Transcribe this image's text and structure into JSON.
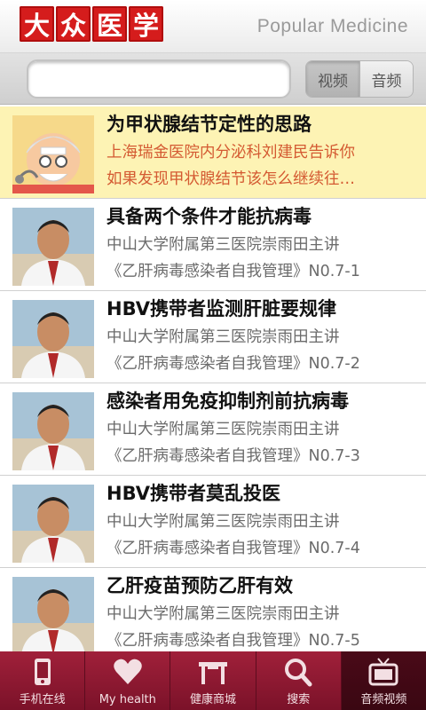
{
  "header": {
    "logo_chars": [
      "大",
      "众",
      "医",
      "学"
    ],
    "brand_text": "Popular Medicine"
  },
  "search": {
    "placeholder": "",
    "toggle": [
      {
        "label": "视频",
        "active": true
      },
      {
        "label": "音频",
        "active": false
      }
    ]
  },
  "list": {
    "items": [
      {
        "title": "为甲状腺结节定性的思路",
        "line1": "上海瑞金医院内分泌科刘建民告诉你",
        "line2": "如果发现甲状腺结节该怎么继续往…",
        "thumb_icon": "doctor-cartoon-icon",
        "highlighted": true
      },
      {
        "title": "具备两个条件才能抗病毒",
        "line1": "中山大学附属第三医院崇雨田主讲",
        "line2": "《乙肝病毒感染者自我管理》N0.7-1",
        "thumb_icon": "doctor-photo",
        "highlighted": false
      },
      {
        "title": "HBV携带者监测肝脏要规律",
        "line1": "中山大学附属第三医院崇雨田主讲",
        "line2": "《乙肝病毒感染者自我管理》N0.7-2",
        "thumb_icon": "doctor-photo",
        "highlighted": false
      },
      {
        "title": "感染者用免疫抑制剂前抗病毒",
        "line1": "中山大学附属第三医院崇雨田主讲",
        "line2": "《乙肝病毒感染者自我管理》N0.7-3",
        "thumb_icon": "doctor-photo",
        "highlighted": false
      },
      {
        "title": "HBV携带者莫乱投医",
        "line1": "中山大学附属第三医院崇雨田主讲",
        "line2": "《乙肝病毒感染者自我管理》N0.7-4",
        "thumb_icon": "doctor-photo",
        "highlighted": false
      },
      {
        "title": "乙肝疫苗预防乙肝有效",
        "line1": "中山大学附属第三医院崇雨田主讲",
        "line2": "《乙肝病毒感染者自我管理》N0.7-5",
        "thumb_icon": "doctor-photo",
        "highlighted": false
      }
    ]
  },
  "bottom_nav": {
    "items": [
      {
        "label": "手机在线",
        "icon": "phone-icon",
        "active": false
      },
      {
        "label": "My health",
        "icon": "heart-icon",
        "active": false
      },
      {
        "label": "健康商城",
        "icon": "store-icon",
        "active": false
      },
      {
        "label": "搜索",
        "icon": "search-icon",
        "active": false
      },
      {
        "label": "音频视频",
        "icon": "tv-icon",
        "active": true
      }
    ]
  },
  "colors": {
    "brand_red": "#d51c1c",
    "nav_bg": "#8c1830",
    "highlight_bg": "#fdf3b4",
    "highlight_text": "#d45a32"
  }
}
